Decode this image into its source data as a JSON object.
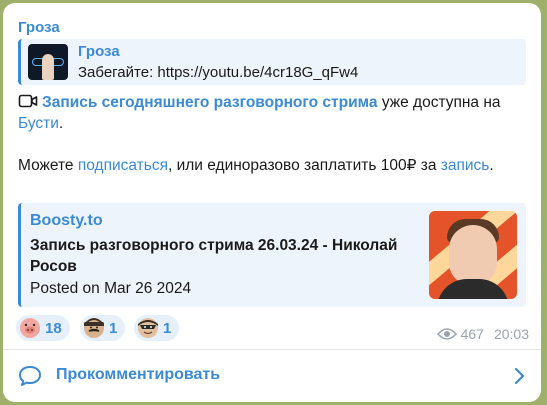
{
  "message": {
    "channel_name": "Гроза",
    "reply": {
      "author": "Гроза",
      "text": "Забегайте: https://youtu.be/4cr18G_qFw4"
    },
    "paragraph1": {
      "link_text": "Запись сегодняшнего разговорного стрима",
      "text_after": " уже доступна на ",
      "link2": "Бусти",
      "end": "."
    },
    "paragraph2": {
      "prefix": "Можете ",
      "link1": "подписаться",
      "middle": ", или единоразово заплатить 100₽ за ",
      "link2": "запись",
      "end": "."
    },
    "preview": {
      "site": "Boosty.to",
      "title": "Запись разговорного стрима 26.03.24 - Николай Росов",
      "description": "Posted on Mar 26 2024"
    },
    "reactions": [
      {
        "icon": "pig-face-icon",
        "count": "18"
      },
      {
        "icon": "mustache-man-icon",
        "count": "1"
      },
      {
        "icon": "mask-man-icon",
        "count": "1"
      }
    ],
    "views": "467",
    "time": "20:03"
  },
  "comments": {
    "label": "Прокомментировать"
  },
  "colors": {
    "accent": "#3a8ad6",
    "background": "#9fb06b",
    "quote_bg": "#eef4fb"
  }
}
